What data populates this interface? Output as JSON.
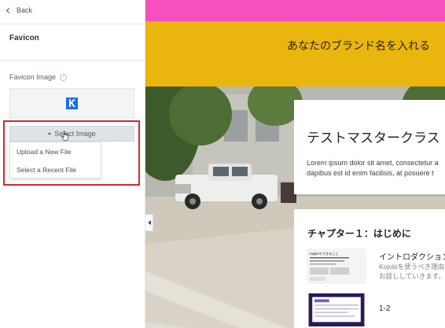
{
  "sidebar": {
    "back_label": "Back",
    "title": "Favicon",
    "field_label": "Favicon Image",
    "select_button_label": "Select Image",
    "dropdown_items": [
      "Upload a New File",
      "Select a Recent File"
    ]
  },
  "preview": {
    "brand_text": "あなたのブランド名を入れる",
    "hero_title": "テストマスタークラス",
    "hero_body_lines": [
      "Lorem ipsum dolor sit amet, consectetur a",
      "dapibus est id enim facilisis, at posuere t"
    ],
    "chapter_title": "チャプター１：はじめに",
    "lessons": [
      {
        "title": "イントロダクション",
        "desc_lines": [
          "Kojobiを使うべき理由、",
          "お話ししていきます。"
        ],
        "thumb_caption": "Kajabiでできること"
      },
      {
        "title": "1-2",
        "desc_lines": []
      }
    ]
  },
  "colors": {
    "pink_bar": "#f74fbe",
    "header_yellow": "#eab60e",
    "highlight_red": "#d9262c",
    "favicon_blue": "#1a6cf0"
  },
  "icons": [
    "chevron-left-icon",
    "info-icon",
    "caret-down-icon",
    "pointer-cursor-icon",
    "collapse-arrow-icon",
    "kajabi-favicon-icon"
  ]
}
